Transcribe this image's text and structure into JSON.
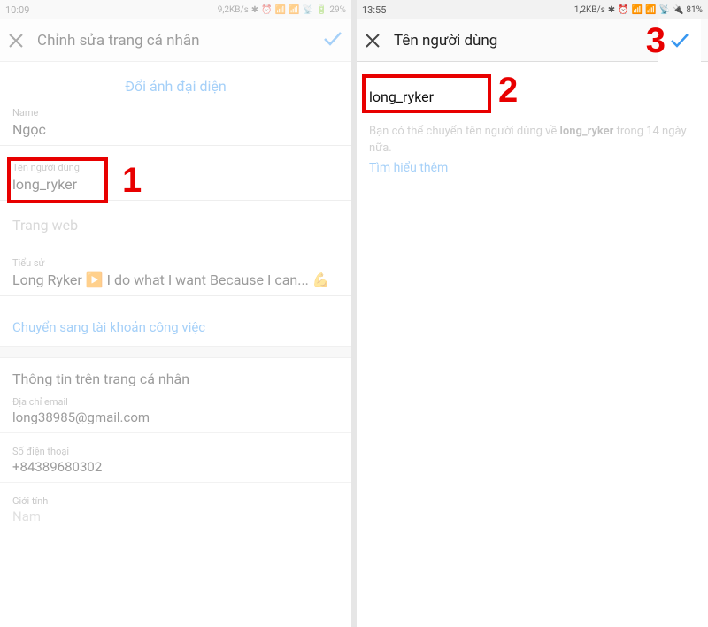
{
  "left": {
    "status": {
      "time": "10:09",
      "speed": "9,2KB/s",
      "battery_pct": "29%"
    },
    "header": {
      "title": "Chỉnh sửa trang cá nhân"
    },
    "avatar_link": "Đổi ảnh đại diện",
    "name": {
      "label": "Name",
      "value": "Ngọc"
    },
    "username": {
      "label": "Tên người dùng",
      "value": "long_ryker"
    },
    "website": {
      "placeholder": "Trang web"
    },
    "bio": {
      "label": "Tiểu sử",
      "value": "Long Ryker ▶️ I do what I want Because I can... 💪"
    },
    "switch_business": "Chuyển sang tài khoản công việc",
    "section_title": "Thông tin trên trang cá nhân",
    "email": {
      "label": "Địa chỉ email",
      "value": "long38985@gmail.com"
    },
    "phone": {
      "label": "Số điện thoại",
      "value": "+84389680302"
    },
    "gender": {
      "label": "Giới tính",
      "value": "Nam"
    }
  },
  "right": {
    "status": {
      "time": "13:55",
      "speed": "1,2KB/s",
      "battery_pct": "81%"
    },
    "header": {
      "title": "Tên người dùng"
    },
    "input_value": "long_ryker",
    "helper_pre": "Bạn có thể chuyển tên người dùng về ",
    "helper_bold": "long_ryker",
    "helper_post": " trong 14 ngày nữa.",
    "learn_more": "Tìm hiểu thêm"
  },
  "annotations": {
    "n1": "1",
    "n2": "2",
    "n3": "3"
  }
}
